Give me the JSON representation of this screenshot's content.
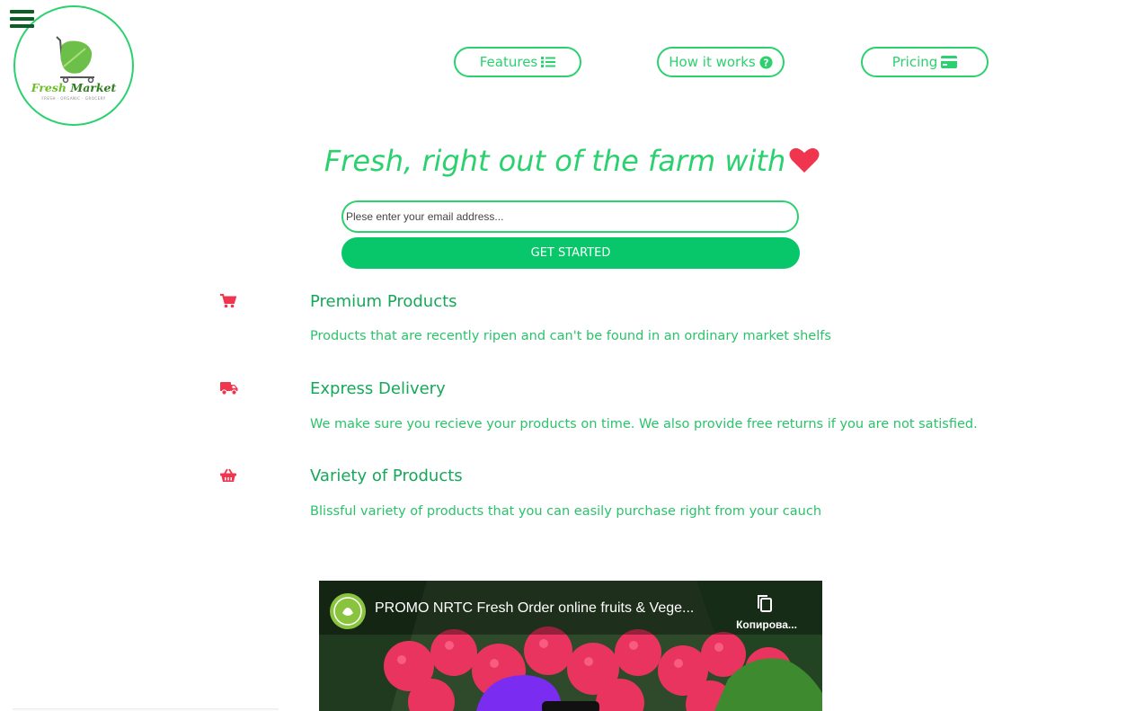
{
  "brand": {
    "name_part1": "Fresh",
    "name_part2": "Market",
    "tagline": "FRESH · ORGANIC · GROCERY",
    "primary_color": "#2bd16f",
    "dark_color": "#0b5e24",
    "accent_color": "#f0354f"
  },
  "nav": [
    {
      "label": "Features",
      "icon": "list-icon"
    },
    {
      "label": "How it works",
      "icon": "question-circle-icon"
    },
    {
      "label": "Pricing",
      "icon": "credit-card-icon"
    }
  ],
  "hero": {
    "title": "Fresh, right out of the farm with",
    "title_icon": "heart-icon",
    "email_placeholder": "Plese enter your email address...",
    "cta_label": "GET STARTED"
  },
  "features": [
    {
      "icon": "shopping-cart-icon",
      "title": "Premium Products",
      "description": "Products that are recently ripen and can't be found in an ordinary market shelfs"
    },
    {
      "icon": "truck-icon",
      "title": "Express Delivery",
      "description": "We make sure you recieve your products on time. We also provide free returns if you are not satisfied."
    },
    {
      "icon": "basket-icon",
      "title": "Variety of Products",
      "description": "Blissful variety of products that you can easily purchase right from your cauch"
    }
  ],
  "video": {
    "title": "PROMO NRTC Fresh Order online fruits & Vege...",
    "copy_label": "Копирова..."
  }
}
